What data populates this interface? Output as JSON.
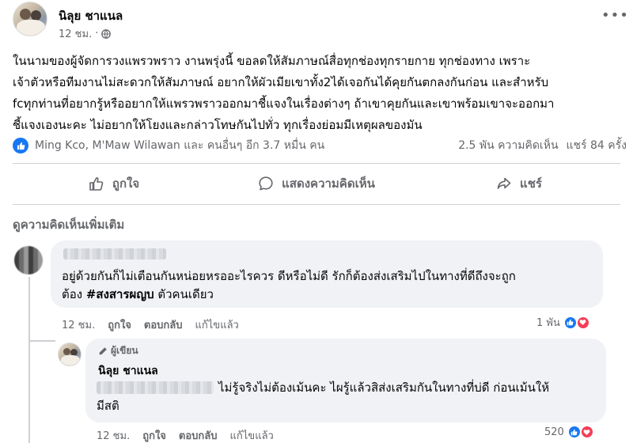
{
  "post": {
    "author": "นิลุย ชาแนล",
    "time": "12 ชม.",
    "body_lines": [
      "ในนามของผู้จัดการวงแพรวพราว งานพรุ่งนี้ ขอลดให้สัมภาษณ์สื่อทุกช่องทุกรายกาย ทุกช่องทาง เพราะ",
      "เจ้าตัวหรือทีมงานไม่สะดวกให้สัมภาษณ์ อยากให้ผัวเมียเขาทั้ง2ได้เจอกันได้คุยกันตกลงกันก่อน และสำหรับ",
      "fcทุกท่านที่อยากรู้หรืออยากให้แพรวพราวออกมาชี้แจงในเรื่องต่างๆ ถ้าเขาคุยกันและเขาพร้อมเขาจะออกมา",
      "ชี้แจงเองนะคะ ไม่อยากให้โยงและกล่าวโทษกันไปทั่ว ทุกเรื่องย่อมมีเหตุผลของมัน"
    ],
    "reactions_text": "Ming Kco, M'Maw Wilawan และ คนอื่นๆ อีก 3.7 หมื่น คน",
    "comments_count": "2.5 พัน ความคิดเห็น",
    "shares_count": "แชร์ 84 ครั้ง"
  },
  "actions": {
    "like": "ถูกใจ",
    "comment": "แสดงความคิดเห็น",
    "share": "แชร์"
  },
  "comments_header": "ดูความคิดเห็นเพิ่มเติม",
  "comment1": {
    "text_line1": "อยู่ด้วยกันก็ไม่เตือนกันหน่อยหรออะไรควร ดีหรือไม่ดี รักก็ต้องส่งเสริมไปในทางที่ดีถึงจะถูก",
    "text_line2_prefix": "ต้อง ",
    "hashtag": "#สงสารผญบ",
    "text_line2_suffix": " ตัวคนเดียว",
    "time": "12 ชม.",
    "like": "ถูกใจ",
    "reply": "ตอบกลับ",
    "edited": "แก้ไขแล้ว",
    "reaction_count": "1 พัน"
  },
  "reply1": {
    "badge": "ผู้เขียน",
    "author": "นิลุย ชาแนล",
    "text_line1": "ไม่รู้จริงไม่ต้องเม้นคะ ไผรู้แล้วสิส่งเสริมกันในทางที่บ่ดี ก่อนเม้นให้",
    "text_line2": "มีสติ",
    "time": "12 ชม.",
    "like": "ถูกใจ",
    "reply": "ตอบกลับ",
    "edited": "แก้ไขแล้ว",
    "reaction_count": "520"
  },
  "colors": {
    "accent": "#1877f2",
    "love": "#f33e58",
    "muted_text": "#65676b",
    "bubble_bg": "#f0f2f5"
  }
}
